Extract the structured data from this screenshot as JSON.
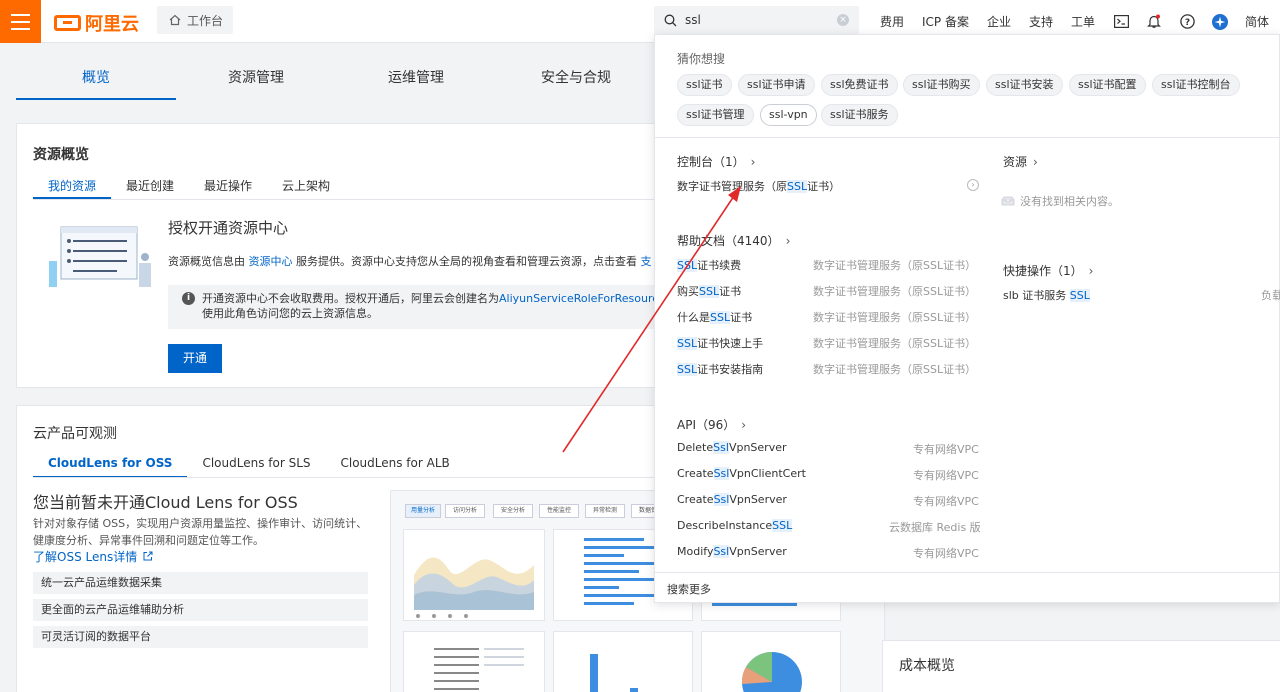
{
  "topbar": {
    "logo_text": "阿里云",
    "workbench_label": "工作台",
    "search_value": "ssl",
    "nav": [
      "费用",
      "ICP 备案",
      "企业",
      "支持",
      "工单"
    ],
    "lang": "简体"
  },
  "main_tabs": [
    "概览",
    "资源管理",
    "运维管理",
    "安全与合规"
  ],
  "resource_overview": {
    "title": "资源概览",
    "tabs": [
      "我的资源",
      "最近创建",
      "最近操作",
      "云上架构"
    ],
    "heading": "授权开通资源中心",
    "desc_prefix": "资源概览信息由",
    "desc_link": "资源中心",
    "desc_suffix": "服务提供。资源中心支持您从全局的视角查看和管理云资源，点击查看",
    "desc_tail": "支",
    "notice_line1": "开通资源中心不会收取费用。授权开通后，阿里云会创建名为",
    "notice_role": "AliyunServiceRoleForResourceDirectory",
    "notice_line2": "使用此角色访问您的云上资源信息。",
    "open_button": "开通"
  },
  "observability": {
    "title": "云产品可观测",
    "tabs": [
      "CloudLens for OSS",
      "CloudLens for SLS",
      "CloudLens for ALB"
    ],
    "heading": "您当前暂未开通Cloud Lens for OSS",
    "desc": "针对对象存储 OSS，实现用户资源用量监控、操作审计、访问统计、健康度分析、异常事件回溯和问题定位等工作。",
    "link": "了解OSS Lens详情",
    "features": [
      "统一云产品运维数据采集",
      "更全面的云产品运维辅助分析",
      "可灵活订阅的数据平台"
    ],
    "dashboard_tabs": [
      "用量分析",
      "访问分析",
      "安全分析",
      "性能监控",
      "异常检测",
      "数据保护"
    ]
  },
  "cost_overview": {
    "title": "成本概览"
  },
  "dropdown": {
    "guess_label": "猜你想搜",
    "suggestions": [
      "ssl证书",
      "ssl证书申请",
      "ssl免费证书",
      "ssl证书购买",
      "ssl证书安装",
      "ssl证书配置",
      "ssl证书控制台",
      "ssl证书管理",
      "ssl-vpn",
      "ssl证书服务"
    ],
    "console": {
      "label": "控制台",
      "count": "（1）",
      "item_prefix": "数字证书管理服务（原",
      "item_hl": "SSL",
      "item_suffix": "证书）"
    },
    "resource": {
      "label": "资源",
      "empty": "没有找到相关内容。"
    },
    "help": {
      "label": "帮助文档",
      "count": "（4140）",
      "items": [
        {
          "pre": "",
          "hl": "SSL",
          "post": "证书续费",
          "source": "数字证书管理服务（原SSL证书）"
        },
        {
          "pre": "购买",
          "hl": "SSL",
          "post": "证书",
          "source": "数字证书管理服务（原SSL证书）"
        },
        {
          "pre": "什么是",
          "hl": "SSL",
          "post": "证书",
          "source": "数字证书管理服务（原SSL证书）"
        },
        {
          "pre": "",
          "hl": "SSL",
          "post": "证书快速上手",
          "source": "数字证书管理服务（原SSL证书）"
        },
        {
          "pre": "",
          "hl": "SSL",
          "post": "证书安装指南",
          "source": "数字证书管理服务（原SSL证书）"
        }
      ]
    },
    "quick": {
      "label": "快捷操作",
      "count": "（1）",
      "item_pre": "slb 证书服务 ",
      "item_hl": "SSL",
      "item_tail": "负载"
    },
    "api": {
      "label": "API",
      "count": "（96）",
      "items": [
        {
          "pre": "Delete",
          "hl": "Ssl",
          "post": "VpnServer",
          "source": "专有网络VPC"
        },
        {
          "pre": "Create",
          "hl": "Ssl",
          "post": "VpnClientCert",
          "source": "专有网络VPC"
        },
        {
          "pre": "Create",
          "hl": "Ssl",
          "post": "VpnServer",
          "source": "专有网络VPC"
        },
        {
          "pre": "DescribeInstance",
          "hl": "SSL",
          "post": "",
          "source": "云数据库 Redis 版"
        },
        {
          "pre": "Modify",
          "hl": "Ssl",
          "post": "VpnServer",
          "source": "专有网络VPC"
        }
      ]
    },
    "more": "搜索更多"
  },
  "colors": {
    "brand": "#ff6a00",
    "primary": "#0064c8",
    "annotation_arrow": "#e02a2a"
  }
}
